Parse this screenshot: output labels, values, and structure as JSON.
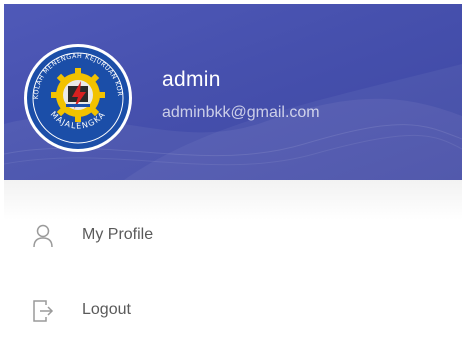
{
  "user": {
    "name": "admin",
    "email": "adminbkk@gmail.com"
  },
  "logo": {
    "icon": "school-emblem-icon",
    "text_top": "SEKOLAH MENENGAH KEJURUAN KORPRI",
    "text_bottom": "MAJALENGKA"
  },
  "menu": {
    "items": [
      {
        "label": "My Profile",
        "icon": "user-icon"
      },
      {
        "label": "Logout",
        "icon": "logout-icon"
      }
    ]
  },
  "colors": {
    "header": "#4650ad",
    "icon": "#9a9a9a",
    "text": "#5a5a5a"
  }
}
